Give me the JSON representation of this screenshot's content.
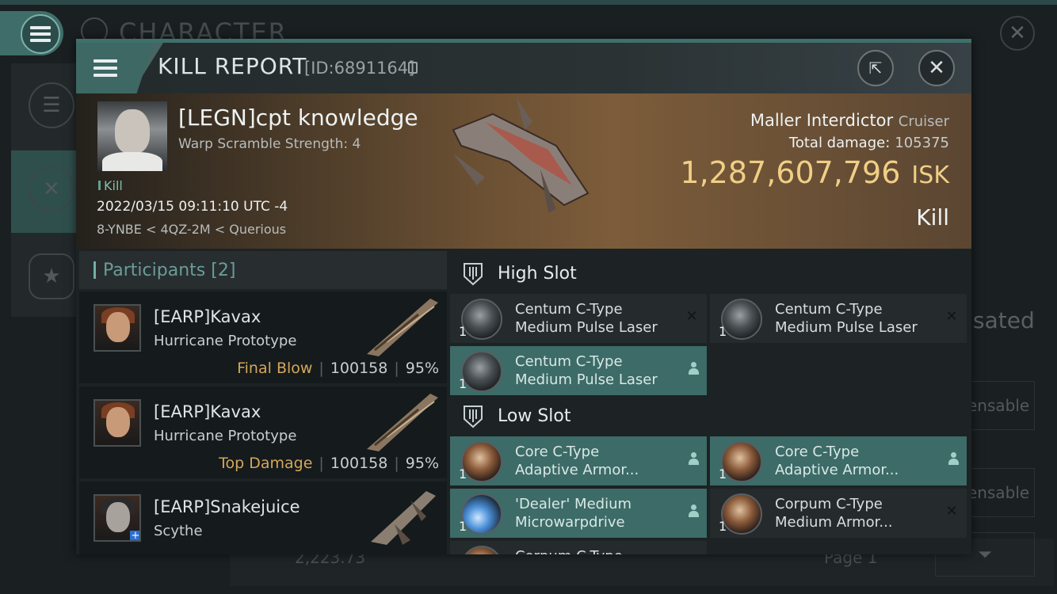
{
  "background": {
    "title": "CHARACTER",
    "right_text": "sated",
    "right_button_1": "ensable",
    "right_button_2": "ensable",
    "bottom_value": "2,223.73",
    "page_label": "Page 1"
  },
  "header": {
    "title": "KILL REPORT",
    "id": "[ID:6891164]"
  },
  "victim": {
    "name": "[LEGN]cpt knowledge",
    "warp_scramble": "Warp Scramble Strength: 4",
    "tag": "Kill",
    "datetime": "2022/03/15 09:11:10 UTC -4",
    "location": "8-YNBE < 4QZ-2M < Querious",
    "ship_name": "Maller Interdictor",
    "ship_class": "Cruiser",
    "total_damage_label": "Total damage:",
    "total_damage": "105375",
    "isk_value": "1,287,607,796",
    "isk_unit": "ISK",
    "result": "Kill"
  },
  "participants": {
    "title": "Participants",
    "count": "[2]",
    "rows": [
      {
        "name": "[EARP]Kavax",
        "ship": "Hurricane Prototype",
        "role": "Final Blow",
        "damage": "100158",
        "percent": "95%"
      },
      {
        "name": "[EARP]Kavax",
        "ship": "Hurricane Prototype",
        "role": "Top Damage",
        "damage": "100158",
        "percent": "95%"
      },
      {
        "name": "[EARP]Snakejuice",
        "ship": "Scythe",
        "role": "",
        "damage": "",
        "percent": ""
      }
    ]
  },
  "slots": {
    "high": {
      "title": "High Slot",
      "modules": [
        {
          "qty": "1",
          "line1": "Centum C-Type",
          "line2": "Medium Pulse Laser",
          "state": "destroyed"
        },
        {
          "qty": "1",
          "line1": "Centum C-Type",
          "line2": "Medium Pulse Laser",
          "state": "destroyed"
        },
        {
          "qty": "1",
          "line1": "Centum C-Type",
          "line2": "Medium Pulse Laser",
          "state": "dropped"
        }
      ]
    },
    "low": {
      "title": "Low Slot",
      "modules": [
        {
          "qty": "1",
          "line1": "Core C-Type",
          "line2": "Adaptive Armor...",
          "state": "dropped"
        },
        {
          "qty": "1",
          "line1": "Core C-Type",
          "line2": "Adaptive Armor...",
          "state": "dropped"
        },
        {
          "qty": "1",
          "line1": "'Dealer' Medium",
          "line2": "Microwarpdrive",
          "state": "dropped"
        },
        {
          "qty": "1",
          "line1": "Corpum C-Type",
          "line2": "Medium Armor...",
          "state": "destroyed"
        },
        {
          "qty": "",
          "line1": "Corpum C-Type",
          "line2": "",
          "state": ""
        }
      ]
    }
  },
  "colors": {
    "accent": "#3d6b67",
    "isk_gold": "#f0cf86",
    "role_gold": "#d4a75a"
  }
}
